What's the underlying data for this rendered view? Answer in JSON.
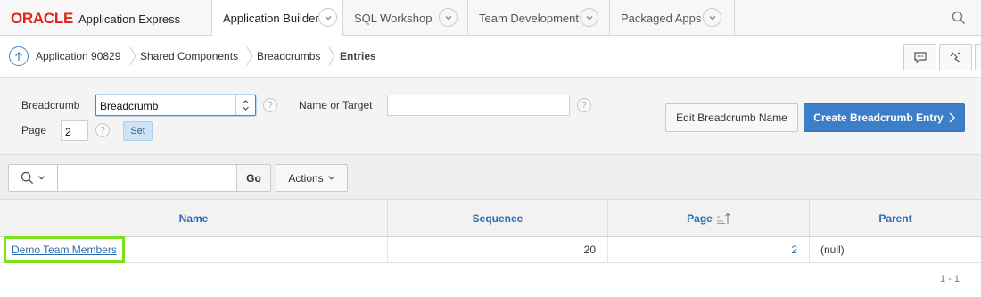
{
  "app": {
    "logo_oracle": "ORACLE",
    "logo_product": "Application Express"
  },
  "nav": {
    "tabs": [
      {
        "label": "Application Builder",
        "active": true
      },
      {
        "label": "SQL Workshop",
        "active": false
      },
      {
        "label": "Team Development",
        "active": false
      },
      {
        "label": "Packaged Apps",
        "active": false
      }
    ],
    "search_icon": "search-icon"
  },
  "breadcrumb": {
    "items": [
      "Application 90829",
      "Shared Components",
      "Breadcrumbs",
      "Entries"
    ],
    "up_icon": "arrow-up-circle-icon",
    "actions": [
      "comment-icon",
      "developer-tools-icon"
    ]
  },
  "form": {
    "breadcrumb_label": "Breadcrumb",
    "breadcrumb_value": "Breadcrumb",
    "name_target_label": "Name or Target",
    "name_target_value": "",
    "page_label": "Page",
    "page_value": "2",
    "help_glyph": "?",
    "set_label": "Set",
    "edit_button": "Edit Breadcrumb Name",
    "create_button": "Create Breadcrumb Entry"
  },
  "report": {
    "search_value": "",
    "go_label": "Go",
    "actions_label": "Actions",
    "columns": [
      "Name",
      "Sequence",
      "Page",
      "Parent"
    ],
    "rows": [
      {
        "name": "Demo Team Members",
        "sequence": "20",
        "page": "2",
        "parent": "(null)"
      }
    ],
    "pagination": "1 - 1"
  },
  "colors": {
    "oracle_red": "#e2231a",
    "primary_blue": "#3c7ec7",
    "link_blue": "#2d6cb0",
    "highlight_green": "#7ae21c"
  }
}
